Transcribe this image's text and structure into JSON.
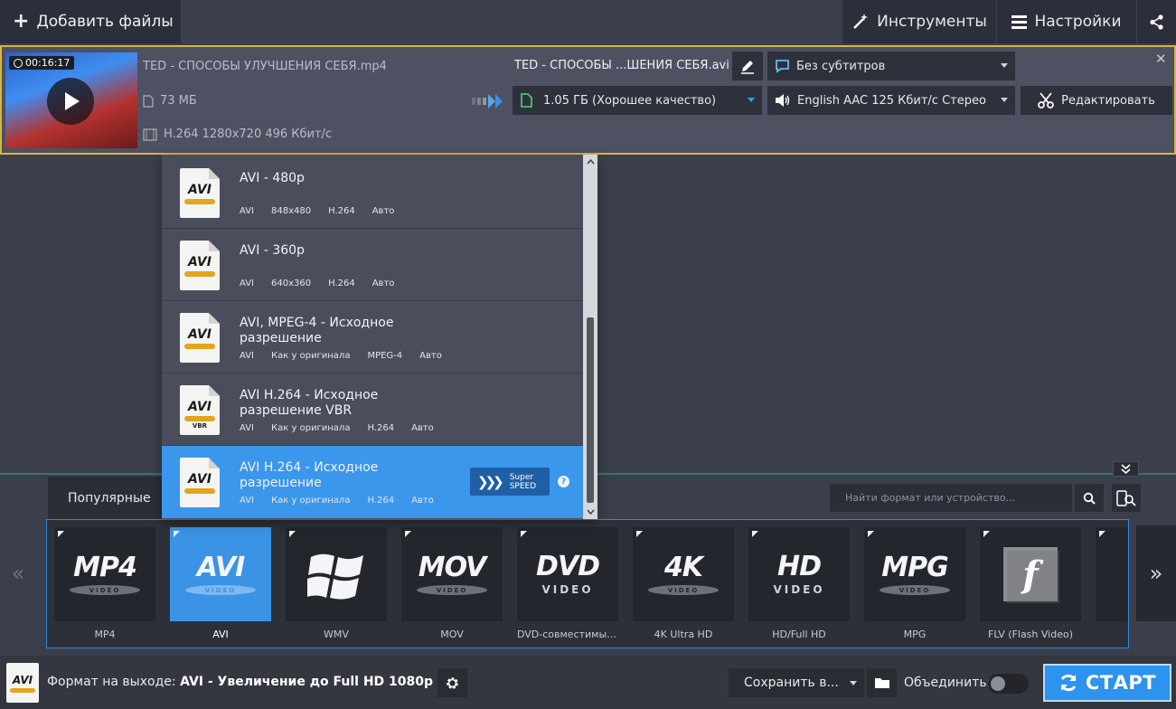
{
  "toolbar": {
    "add_files": "Добавить файлы",
    "tools": "Инструменты",
    "settings": "Настройки"
  },
  "file": {
    "duration": "00:16:17",
    "source_name": "TED - СПОСОБЫ УЛУЧШЕНИЯ СЕБЯ.mp4",
    "source_size": "73 МБ",
    "source_codec": "H.264 1280x720 496 Кбит/с",
    "output_name": "TED - СПОСОБЫ ...ШЕНИЯ СЕБЯ.avi",
    "output_size": "1.05 ГБ (Хорошее качество)",
    "subtitles": "Без субтитров",
    "audio": "English AAC 125 Кбит/с Стерео",
    "edit": "Редактировать"
  },
  "dropdown": {
    "items": [
      {
        "title": "AVI - 480p",
        "specs": [
          "AVI",
          "848x480",
          "H.264",
          "Авто"
        ],
        "icon_text": "AVI",
        "vbr": ""
      },
      {
        "title": "AVI - 360p",
        "specs": [
          "AVI",
          "640x360",
          "H.264",
          "Авто"
        ],
        "icon_text": "AVI",
        "vbr": ""
      },
      {
        "title": "AVI, MPEG-4 - Исходное разрешение",
        "specs": [
          "AVI",
          "Как у оригинала",
          "MPEG-4",
          "Авто"
        ],
        "icon_text": "AVI",
        "vbr": ""
      },
      {
        "title": "AVI H.264 - Исходное разрешение VBR",
        "specs": [
          "AVI",
          "Как у оригинала",
          "H.264",
          "Авто"
        ],
        "icon_text": "AVI",
        "vbr": "VBR"
      },
      {
        "title": "AVI H.264 - Исходное разрешение",
        "specs": [
          "AVI",
          "Как у оригинала",
          "H.264",
          "Авто"
        ],
        "icon_text": "AVI",
        "vbr": "",
        "selected": true
      }
    ],
    "superspeed_line1": "Super",
    "superspeed_line2": "SPEED",
    "help": "?"
  },
  "formats": {
    "tab": "Популярные",
    "search_placeholder": "Найти формат или устройство...",
    "tiles": [
      {
        "label": "MP4",
        "logo": "MP4",
        "sub": "VIDEO"
      },
      {
        "label": "AVI",
        "logo": "AVI",
        "sub": "VIDEO",
        "selected": true
      },
      {
        "label": "WMV",
        "logo": "",
        "sub": ""
      },
      {
        "label": "MOV",
        "logo": "MOV",
        "sub": "VIDEO"
      },
      {
        "label": "DVD-совместимые в...",
        "logo": "DVD",
        "sub": "VIDEO"
      },
      {
        "label": "4K Ultra HD",
        "logo": "4K",
        "sub": "VIDEO"
      },
      {
        "label": "HD/Full HD",
        "logo": "HD",
        "sub": "VIDEO"
      },
      {
        "label": "MPG",
        "logo": "MPG",
        "sub": "VIDEO"
      },
      {
        "label": "FLV (Flash Video)",
        "logo": "f",
        "sub": ""
      }
    ]
  },
  "bottom": {
    "icon_text": "AVI",
    "format_prefix": "Формат на выходе:",
    "format_value": "AVI - Увеличение до Full HD 1080p",
    "save_to": "Сохранить в...",
    "merge": "Объединить:",
    "start": "СТАРТ"
  }
}
